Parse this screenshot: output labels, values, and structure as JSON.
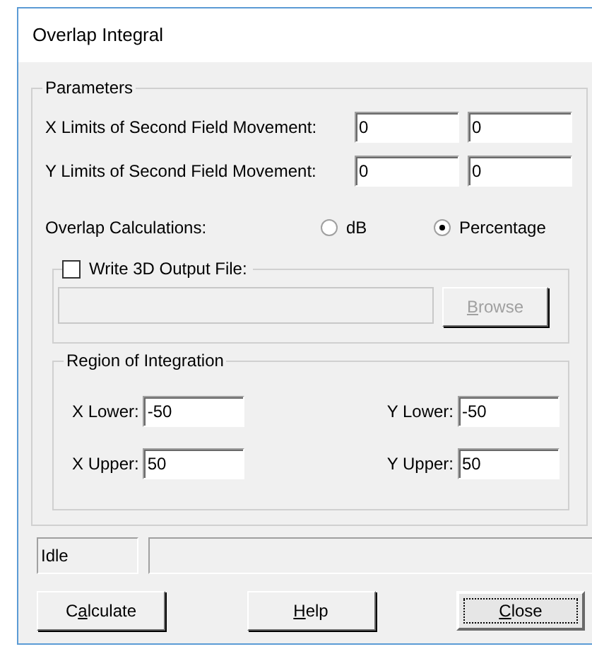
{
  "window": {
    "title": "Overlap Integral"
  },
  "parameters": {
    "title": "Parameters",
    "limits": [
      {
        "label": "X Limits of Second Field Movement:",
        "values": [
          "0",
          "0"
        ]
      },
      {
        "label": "Y Limits of Second Field Movement:",
        "values": [
          "0",
          "0"
        ]
      }
    ],
    "overlap": {
      "label": "Overlap Calculations:",
      "options": [
        {
          "label": "dB",
          "selected": false
        },
        {
          "label": "Percentage",
          "selected": true
        }
      ]
    },
    "output_file": {
      "label": "Write 3D Output File:",
      "checked": false,
      "disabled": true,
      "browse": {
        "mnemonic": "B",
        "after": "rowse"
      }
    },
    "region": {
      "title": "Region of Integration",
      "fields": [
        {
          "label": "X Lower:",
          "value": "-50"
        },
        {
          "label": "Y Lower:",
          "value": "-50"
        },
        {
          "label": "X Upper:",
          "value": "50"
        },
        {
          "label": "Y Upper:",
          "value": "50"
        }
      ]
    }
  },
  "status_bar": {
    "state": "Idle"
  },
  "buttons": [
    {
      "before": "C",
      "mnemonic": "a",
      "after": "lculate",
      "focused": false
    },
    {
      "mnemonic": "H",
      "after": "elp",
      "focused": false
    },
    {
      "mnemonic": "C",
      "after": "lose",
      "focused": true
    }
  ]
}
